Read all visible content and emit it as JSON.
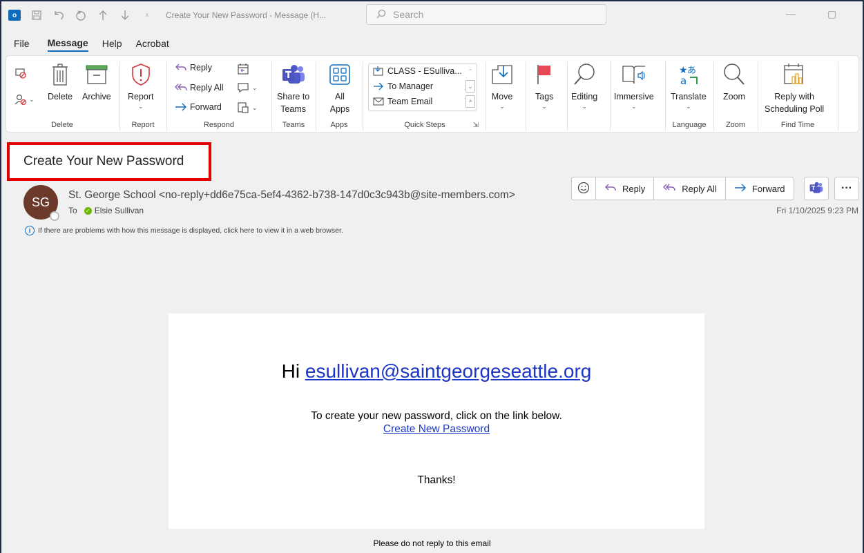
{
  "titlebar": {
    "app_icon": "outlook-logo",
    "title": "Create Your New Password  -  Message (H...",
    "search_placeholder": "Search"
  },
  "menu": [
    "File",
    "Message",
    "Help",
    "Acrobat"
  ],
  "ribbon": {
    "delete_group": {
      "label": "Delete",
      "delete": "Delete",
      "archive": "Archive"
    },
    "report_group": {
      "label": "Report",
      "report": "Report"
    },
    "respond_group": {
      "label": "Respond",
      "reply": "Reply",
      "reply_all": "Reply All",
      "forward": "Forward"
    },
    "teams_group": {
      "label": "Teams",
      "share1": "Share to",
      "share2": "Teams"
    },
    "apps_group": {
      "label": "Apps",
      "all": "All",
      "apps": "Apps"
    },
    "quicksteps_group": {
      "label": "Quick Steps",
      "items": [
        "CLASS - ESulliva...",
        "To Manager",
        "Team Email"
      ]
    },
    "move": "Move",
    "tags": "Tags",
    "editing": "Editing",
    "immersive": "Immersive",
    "language_group": {
      "label": "Language",
      "translate": "Translate"
    },
    "zoom_group": {
      "label": "Zoom",
      "zoom": "Zoom"
    },
    "findtime_group": {
      "label": "Find Time",
      "line1": "Reply with",
      "line2": "Scheduling Poll"
    }
  },
  "message": {
    "subject": "Create Your New Password",
    "avatar_initials": "SG",
    "sender": "St. George School <no-reply+dd6e75ca-5ef4-4362-b738-147d0c3c943b@site-members.com>",
    "to_label": "To",
    "recipient": "Elsie Sullivan",
    "info": "If there are problems with how this message is displayed, click here to view it in a web browser.",
    "actions": {
      "reply": "Reply",
      "reply_all": "Reply All",
      "forward": "Forward"
    },
    "datetime": "Fri 1/10/2025 9:23 PM"
  },
  "body": {
    "greeting_prefix": "Hi",
    "email_link": "esullivan@saintgeorgeseattle.org",
    "instruction": "To create your new password, click on the link below.",
    "create_link": "Create New Password",
    "thanks": "Thanks!",
    "footer": "Please do not reply to this email"
  },
  "colors": {
    "accent": "#0f6cbd",
    "highlight_box": "#e00000",
    "avatar": "#6b3a2a",
    "link": "#1b35c9"
  }
}
